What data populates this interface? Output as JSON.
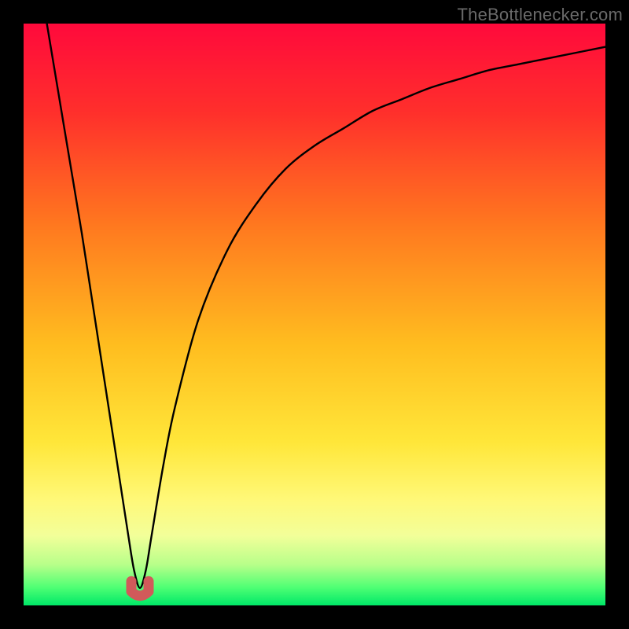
{
  "watermark": {
    "text": "TheBottlenecker.com"
  },
  "chart_data": {
    "type": "line",
    "title": "",
    "xlabel": "",
    "ylabel": "",
    "xlim": [
      0,
      100
    ],
    "ylim": [
      0,
      100
    ],
    "grid": false,
    "series": [
      {
        "name": "bottleneck-curve",
        "x": [
          4,
          6,
          8,
          10,
          12,
          14,
          16,
          18,
          19,
          20,
          21,
          22,
          24,
          26,
          30,
          35,
          40,
          45,
          50,
          55,
          60,
          65,
          70,
          75,
          80,
          85,
          90,
          95,
          100
        ],
        "y": [
          100,
          88,
          76,
          64,
          51,
          38,
          25,
          12,
          6,
          3,
          6,
          12,
          24,
          34,
          49,
          61,
          69,
          75,
          79,
          82,
          85,
          87,
          89,
          90.5,
          92,
          93,
          94,
          95,
          96
        ]
      }
    ],
    "marker": {
      "name": "optimal-point",
      "x": 20,
      "y": 2,
      "shape": "u",
      "color": "#d15a5a"
    },
    "background_gradient": {
      "stops": [
        {
          "offset": 0.0,
          "color": "#ff0a3c"
        },
        {
          "offset": 0.15,
          "color": "#ff2f2c"
        },
        {
          "offset": 0.35,
          "color": "#ff7a1f"
        },
        {
          "offset": 0.55,
          "color": "#ffbd1f"
        },
        {
          "offset": 0.72,
          "color": "#ffe73a"
        },
        {
          "offset": 0.82,
          "color": "#fff97a"
        },
        {
          "offset": 0.88,
          "color": "#f3ff9a"
        },
        {
          "offset": 0.93,
          "color": "#b8ff8a"
        },
        {
          "offset": 0.97,
          "color": "#4dff74"
        },
        {
          "offset": 1.0,
          "color": "#00e868"
        }
      ]
    }
  }
}
